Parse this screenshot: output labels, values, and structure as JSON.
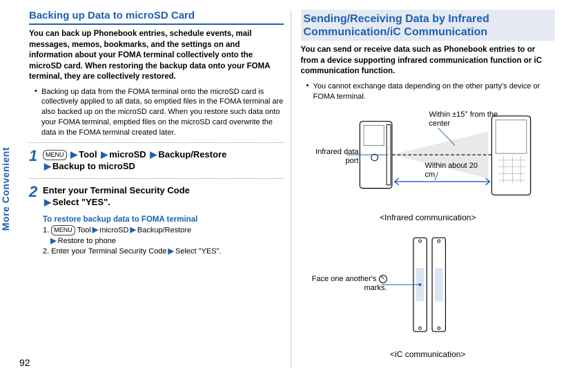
{
  "side_tab": "More Convenient",
  "page_number": "92",
  "left": {
    "title": "Backing up Data to microSD Card",
    "intro": "You can back up Phonebook entries, schedule events, mail messages, memos, bookmarks, and the settings on and information about your FOMA terminal collectively onto the microSD card. When restoring the backup data onto your FOMA terminal, they are collectively restored.",
    "bullet1": "Backing up data from the FOMA terminal onto the microSD card is collectively applied to all data, so emptied files in the FOMA terminal are also backed up on the microSD card. When you restore such data onto your FOMA terminal, emptied files on the microSD card overwrite the data in the FOMA terminal created later.",
    "menu_key": "MENU",
    "step1_tool": "Tool",
    "step1_microsd": "microSD",
    "step1_br": "Backup/Restore",
    "step1_target": "Backup to microSD",
    "step2_line1": "Enter your Terminal Security Code",
    "step2_line2": "Select \"YES\".",
    "restore_title": "To restore backup data to FOMA terminal",
    "r1_leading": "1.",
    "r1_tool": "Tool",
    "r1_microsd": "microSD",
    "r1_br": "Backup/Restore",
    "r1_target": "Restore to phone",
    "r2": "2. Enter your Terminal Security Code",
    "r2_select": "Select \"YES\"."
  },
  "right": {
    "title": "Sending/Receiving Data by Infrared Communication/iC Communication",
    "intro": "You can send or receive data such as Phonebook entries to or from a device supporting infrared communication function or iC communication function.",
    "bullet1": "You cannot exchange data depending on the other party's device or FOMA terminal.",
    "label_ir_port": "Infrared data port",
    "label_angle": "Within ±15° from the center",
    "label_distance": "Within about 20 cm",
    "caption_ir": "<Infrared communication>",
    "label_face_pre": "Face one another's ",
    "label_face_post": " marks.",
    "caption_ic": "<iC communication>"
  }
}
